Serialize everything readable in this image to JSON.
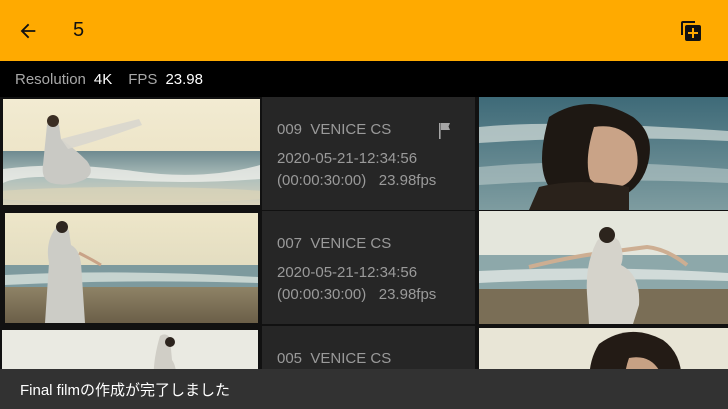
{
  "topbar": {
    "count": "5",
    "back_icon": "arrow-left-icon",
    "add_icon": "add-clip-icon"
  },
  "info": {
    "resolution_label": "Resolution",
    "resolution_value": "4K",
    "fps_label": "FPS",
    "fps_value": "23.98"
  },
  "clips": [
    {
      "id": "009",
      "camera": "VENICE CS",
      "datetime": "2020-05-21-12:34:56",
      "duration": "(00:00:30:00)",
      "fps": "23.98fps",
      "flagged": true
    },
    {
      "id": "007",
      "camera": "VENICE CS",
      "datetime": "2020-05-21-12:34:56",
      "duration": "(00:00:30:00)",
      "fps": "23.98fps",
      "flagged": false
    },
    {
      "id": "005",
      "camera": "VENICE CS",
      "flagged": false
    }
  ],
  "snackbar": {
    "message": "Final filmの作成が完了しました"
  },
  "colors": {
    "accent": "#FFAA00",
    "meta_bg": "#262626",
    "snackbar_bg": "#323232"
  }
}
